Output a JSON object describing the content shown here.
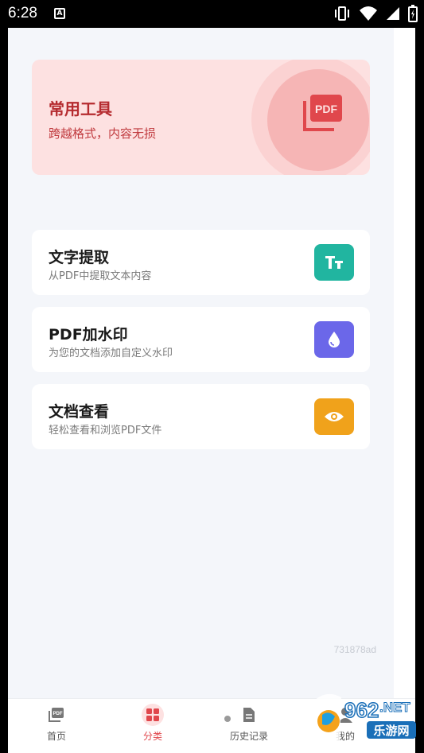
{
  "status_bar": {
    "time": "6:28",
    "notification_glyph": "A"
  },
  "hero": {
    "title": "常用工具",
    "subtitle": "跨越格式，内容无损",
    "icon": "pdf-icon",
    "icon_text": "PDF"
  },
  "tools": [
    {
      "title": "文字提取",
      "desc": "从PDF中提取文本内容",
      "icon": "text-icon",
      "icon_text": "TT",
      "color": "#21b5a0"
    },
    {
      "title": "PDF加水印",
      "desc": "为您的文档添加自定义水印",
      "icon": "water-drop-icon",
      "color": "#6b67e9"
    },
    {
      "title": "文档查看",
      "desc": "轻松查看和浏览PDF文件",
      "icon": "eye-icon",
      "color": "#f0a21b"
    }
  ],
  "version": "731878ad",
  "nav": {
    "home": "首页",
    "category": "分类",
    "history": "历史记录",
    "profile": "我的"
  },
  "colors": {
    "accent": "#e0474c",
    "hero_bg": "#fde1e1"
  },
  "watermark": {
    "brand_top": "962",
    "brand_net": ".NET",
    "brand_bottom": "乐游网"
  }
}
